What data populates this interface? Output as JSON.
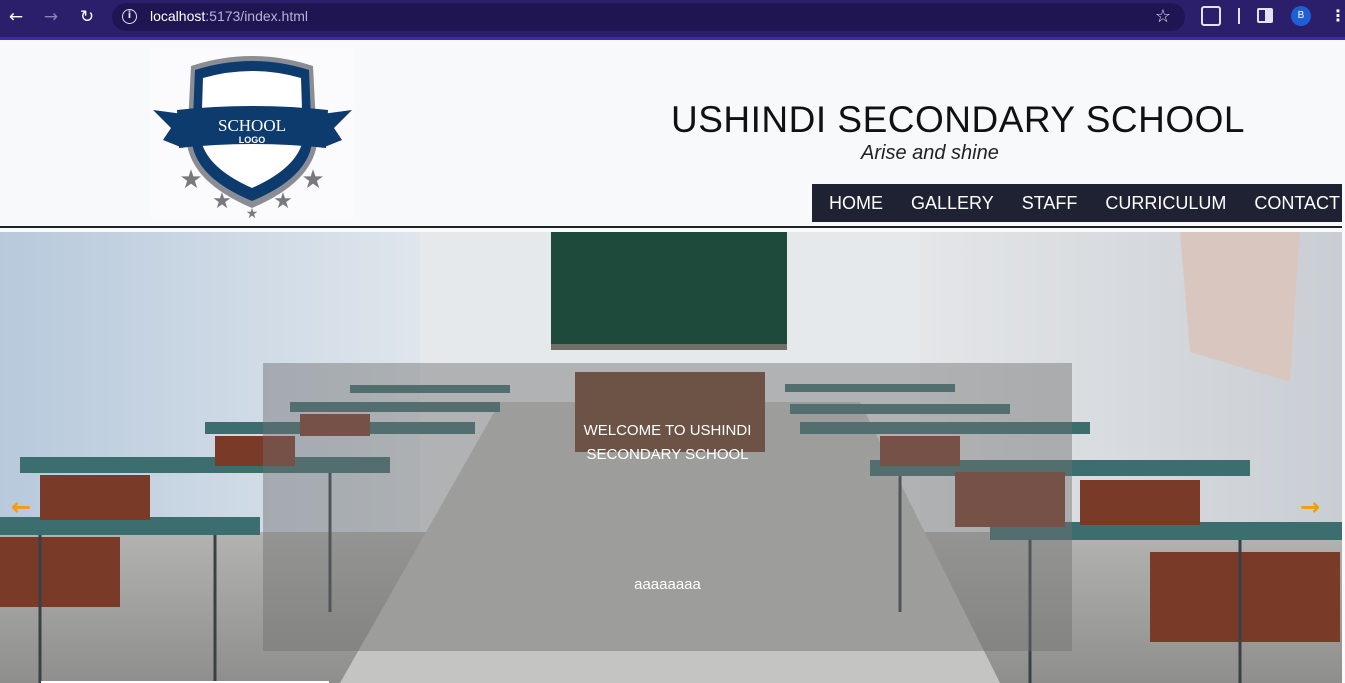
{
  "browser": {
    "url_host": "localhost",
    "url_rest": ":5173/index.html",
    "profile_initial": "B",
    "icons": [
      "back-icon",
      "forward-icon",
      "reload-icon",
      "info-icon",
      "star-icon",
      "extensions-icon",
      "side-panel-icon",
      "menu-icon"
    ]
  },
  "header": {
    "logo_text_1": "SCHOOL",
    "logo_text_2": "LOGO",
    "title": "USHINDI SECONDARY SCHOOL",
    "tagline": "Arise and shine"
  },
  "nav": {
    "items": [
      {
        "label": "HOME"
      },
      {
        "label": "GALLERY"
      },
      {
        "label": "STAFF"
      },
      {
        "label": "CURRICULUM"
      },
      {
        "label": "CONTACT US"
      }
    ]
  },
  "carousel": {
    "caption_title_line1": "WELCOME TO USHINDI",
    "caption_title_line2": "SECONDARY SCHOOL",
    "caption_text": "aaaaaaaa",
    "prev_symbol": "←",
    "next_symbol": "→",
    "arrow_color": "#f39c12"
  },
  "colors": {
    "chrome": "#2b1f6b",
    "nav_bg": "#1f2233",
    "logo_blue": "#0d3b6e"
  }
}
